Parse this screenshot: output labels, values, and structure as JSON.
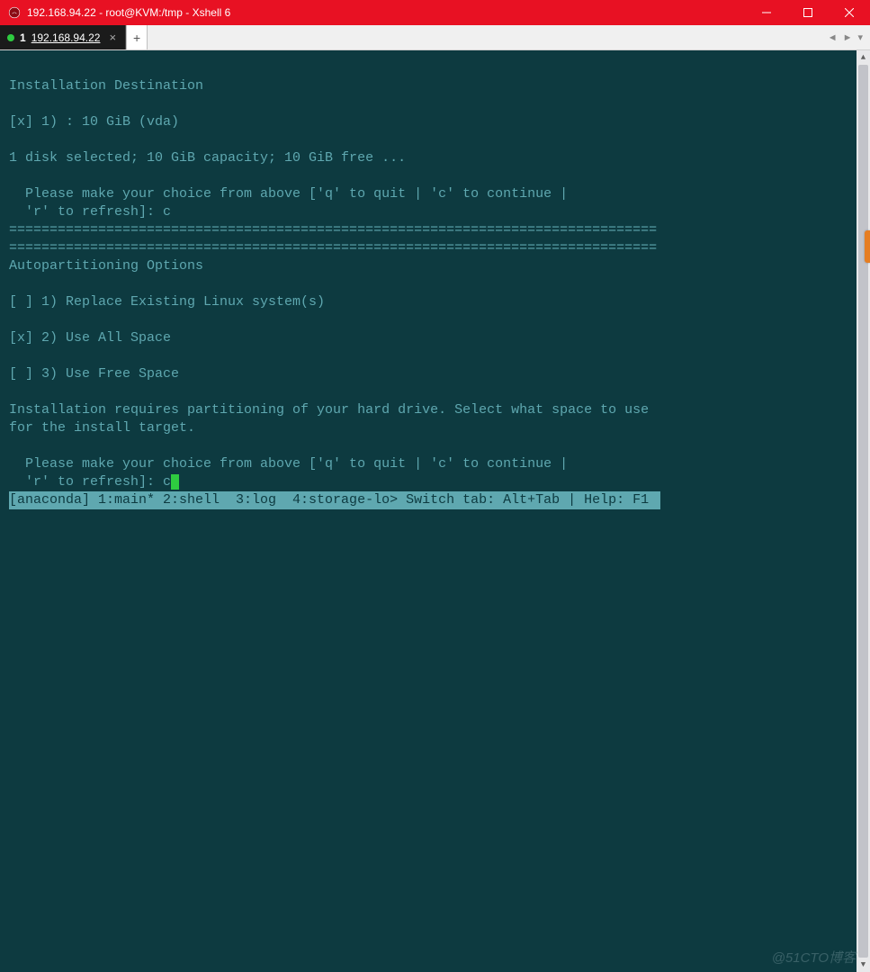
{
  "window": {
    "title": "192.168.94.22 - root@KVM:/tmp - Xshell 6"
  },
  "tabbar": {
    "tab_number": "1",
    "tab_label": "192.168.94.22",
    "newtab_label": "+",
    "nav_left": "◄",
    "nav_right": "►",
    "nav_menu": "▾"
  },
  "terminal": {
    "lines": {
      "l0": "Installation Destination",
      "l1": "",
      "l2": "[x] 1) : 10 GiB (vda)",
      "l3": "",
      "l4": "1 disk selected; 10 GiB capacity; 10 GiB free ...",
      "l5": "",
      "l6": "  Please make your choice from above ['q' to quit | 'c' to continue |",
      "l7": "  'r' to refresh]: c",
      "l8": "================================================================================",
      "l9": "================================================================================",
      "l10": "Autopartitioning Options",
      "l11": "",
      "l12": "[ ] 1) Replace Existing Linux system(s)",
      "l13": "",
      "l14": "[x] 2) Use All Space",
      "l15": "",
      "l16": "[ ] 3) Use Free Space",
      "l17": "",
      "l18": "Installation requires partitioning of your hard drive. Select what space to use",
      "l19": "for the install target.",
      "l20": "",
      "l21": "  Please make your choice from above ['q' to quit | 'c' to continue |",
      "l22": "  'r' to refresh]: c"
    },
    "statusline": "[anaconda] 1:main* 2:shell  3:log  4:storage-lo> Switch tab: Alt+Tab | Help: F1 "
  },
  "watermark": "@51CTO博客"
}
